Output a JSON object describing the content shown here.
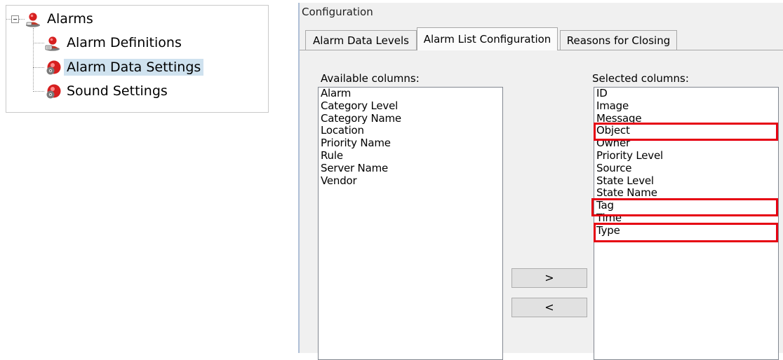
{
  "tree": {
    "root": {
      "label": "Alarms",
      "icon": "alarm-user-icon",
      "expanded": true
    },
    "children": [
      {
        "label": "Alarm Definitions",
        "icon": "alarm-definition-icon",
        "selected": false
      },
      {
        "label": "Alarm Data Settings",
        "icon": "alarm-settings-icon",
        "selected": true
      },
      {
        "label": "Sound Settings",
        "icon": "sound-settings-icon",
        "selected": false
      }
    ]
  },
  "config": {
    "title": "Configuration",
    "tabs": [
      {
        "label": "Alarm Data Levels",
        "active": false
      },
      {
        "label": "Alarm List Configuration",
        "active": true
      },
      {
        "label": "Reasons for Closing",
        "active": false
      }
    ],
    "available": {
      "caption": "Available columns:",
      "items": [
        "Alarm",
        "Category Level",
        "Category Name",
        "Location",
        "Priority Name",
        "Rule",
        "Server Name",
        "Vendor"
      ]
    },
    "selected": {
      "caption": "Selected columns:",
      "items": [
        "ID",
        "Image",
        "Message",
        "Object",
        "Owner",
        "Priority Level",
        "Source",
        "State Level",
        "State Name",
        "Tag",
        "Time",
        "Type"
      ],
      "highlighted": [
        "Object",
        "Tag",
        "Type"
      ]
    },
    "buttons": {
      "add": ">",
      "remove": "<"
    }
  },
  "colors": {
    "highlight": "#e60012",
    "selection": "#cfe2ef",
    "window_bg": "#f0f0f0"
  }
}
